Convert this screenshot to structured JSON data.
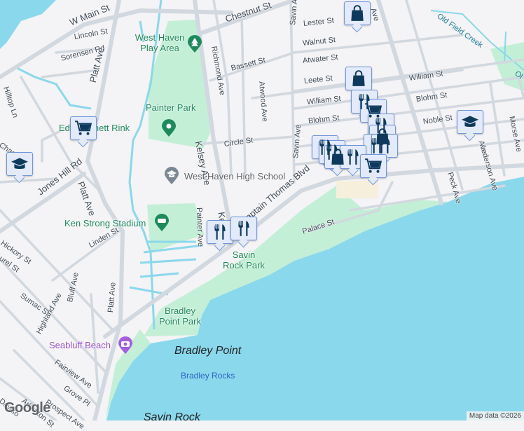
{
  "colors": {
    "land": "#f4f3f5",
    "water": "#8ad8ec",
    "park": "#c3efd6",
    "road": "#d6dbe1",
    "marker_bg": "#e2eafb",
    "marker_icon": "#0d3a5c"
  },
  "streets": {
    "w_main": "W Main St",
    "chestnut": "Chestnut St",
    "lincoln": "Lincoln St",
    "sorensen": "Sorensen Rd",
    "hilltop": "Hilltop Ln",
    "platt1": "Platt Ave",
    "platt2": "Platt Ave",
    "platt3": "Platt Ave",
    "richmond": "Richmond Ave",
    "bassett": "Bassett St",
    "atwood": "Atwood Ave",
    "kelsey1": "Kelsey Ave",
    "kelsey2": "Kelse",
    "circle": "Circle St",
    "painter": "Painter Ave",
    "jones_hill": "Jones Hill Rd",
    "chase": "Chase",
    "savin1": "Savin Ave",
    "savin2": "Savin Ave",
    "lester": "Lester St",
    "walnut": "Walnut St",
    "atwater": "Atwater St",
    "leete": "Leete St",
    "william1": "William St",
    "william2": "William St",
    "blohm1": "Blohm St",
    "blohm2": "Blohm St",
    "noble": "Noble St",
    "peck": "Peck Ave",
    "anderson": "Anderson Ave",
    "morse": "Morse Ave",
    "ave_top": "Ave",
    "ave_mid": "Ave",
    "captain": "Captain Thomas Blvd",
    "palace": "Palace St",
    "linden": "Linden St",
    "hickory": "Hickory St",
    "laurel": "urel St",
    "sumac": "Sumac St",
    "highland": "Highland Ave",
    "bluff": "Bluff Ave",
    "fairview": "Fairview Ave",
    "grove": "Grove Pl",
    "prospect": "Prospect Ave",
    "arlington": "Arlington St",
    "dawson": "Dawso"
  },
  "places": {
    "play_area": "West Haven Play Area",
    "painter_park": "Painter Park",
    "rink": "Ed      . Bennett Rink",
    "high_school": "West Haven High School",
    "ken_strong": "Ken Strong Stadium",
    "savin_rock_park": "Savin Rock Park",
    "bradley_point_park": "Bradley Point Park",
    "seabluff": "Seabluff Beach",
    "old_field_creek": "Old Field Creek",
    "old_field_creek2": "Ol",
    "bradley_point": "Bradley Point",
    "bradley_rocks": "Bradley Rocks",
    "savin_rock": "Savin Rock"
  },
  "markers": [
    {
      "icon": "shopping-bag"
    },
    {
      "icon": "shopping-bag"
    },
    {
      "icon": "fork-knife"
    },
    {
      "icon": "cart"
    },
    {
      "icon": "fork-knife"
    },
    {
      "icon": "shopping-bag"
    },
    {
      "icon": "fork-knife"
    },
    {
      "icon": "fork-knife"
    },
    {
      "icon": "fork-knife"
    },
    {
      "icon": "fork-knife"
    },
    {
      "icon": "shopping-bag"
    },
    {
      "icon": "fork-knife"
    },
    {
      "icon": "cart"
    },
    {
      "icon": "cart"
    },
    {
      "icon": "school"
    },
    {
      "icon": "school"
    },
    {
      "icon": "fork-knife"
    },
    {
      "icon": "fork-knife"
    }
  ],
  "footer": {
    "logo": "Google",
    "attribution": "Map data ©2026"
  }
}
